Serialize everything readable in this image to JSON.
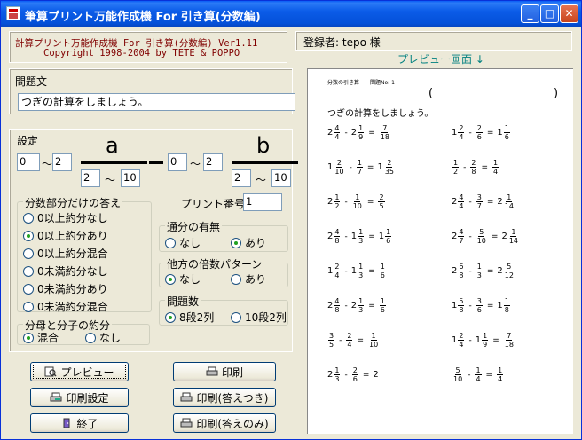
{
  "window": {
    "title": "筆算プリント万能作成機 For 引き算(分数編)"
  },
  "info": {
    "line1": "計算プリント万能作成機 For 引き算(分数編) Ver1.11",
    "line2": "Copyright 1998-2004 by TETE & POPPO"
  },
  "question": {
    "label": "問題文",
    "value": "つぎの計算をしましょう。"
  },
  "settings": {
    "label": "設定",
    "a_label": "a",
    "b_label": "b",
    "a_whole_from": "0",
    "a_whole_to": "2",
    "a_den_from": "2",
    "a_den_to": "10",
    "b_whole_from": "0",
    "b_whole_to": "2",
    "b_den_from": "2",
    "b_den_to": "10",
    "tilde": "〜"
  },
  "answer_group": {
    "label": "分数部分だけの答え",
    "options": [
      {
        "label": "0以上約分なし",
        "checked": false
      },
      {
        "label": "0以上約分あり",
        "checked": true
      },
      {
        "label": "0以上約分混合",
        "checked": false
      },
      {
        "label": "0未満約分なし",
        "checked": false
      },
      {
        "label": "0未満約分あり",
        "checked": false
      },
      {
        "label": "0未満約分混合",
        "checked": false
      }
    ]
  },
  "reduce_group": {
    "label": "分母と分子の約分",
    "options": [
      {
        "label": "混合",
        "checked": true
      },
      {
        "label": "なし",
        "checked": false
      }
    ]
  },
  "print_number": {
    "label": "プリント番号",
    "value": "1"
  },
  "tsubun_group": {
    "label": "通分の有無",
    "options": [
      {
        "label": "なし",
        "checked": false
      },
      {
        "label": "あり",
        "checked": true
      }
    ]
  },
  "multiple_group": {
    "label": "他方の倍数パターン",
    "options": [
      {
        "label": "なし",
        "checked": true
      },
      {
        "label": "あり",
        "checked": false
      }
    ]
  },
  "count_group": {
    "label": "問題数",
    "options": [
      {
        "label": "8段2列",
        "checked": true
      },
      {
        "label": "10段2列",
        "checked": false
      }
    ]
  },
  "buttons": {
    "preview": "プレビュー",
    "print_settings": "印刷設定",
    "exit": "終了",
    "print": "印刷",
    "print_with_answers": "印刷(答えつき)",
    "print_answers_only": "印刷(答えのみ)"
  },
  "registrant": "登録者: tepo 様",
  "preview_title": "プレビュー画面 ↓",
  "sheet": {
    "header": "分数の引き算　　問題No: 1",
    "paren_open": "(",
    "paren_close": ")",
    "instruction": "つぎの計算をしましょう。",
    "problems": [
      {
        "a": [
          "2",
          "4",
          "4"
        ],
        "b": [
          "2",
          "1",
          "9"
        ],
        "r": [
          "",
          "7",
          "18"
        ]
      },
      {
        "a": [
          "1",
          "2",
          "4"
        ],
        "b": [
          "",
          "2",
          "6"
        ],
        "r": [
          "1",
          "1",
          "6"
        ]
      },
      {
        "a": [
          "1",
          "2",
          "10"
        ],
        "b": [
          "",
          "1",
          "7"
        ],
        "r": [
          "1",
          "2",
          "35"
        ]
      },
      {
        "a": [
          "",
          "1",
          "2"
        ],
        "b": [
          "",
          "2",
          "8"
        ],
        "r": [
          "",
          "1",
          "4"
        ]
      },
      {
        "a": [
          "2",
          "1",
          "2"
        ],
        "b": [
          "",
          "1",
          "10"
        ],
        "r": [
          "",
          "2",
          "5"
        ]
      },
      {
        "a": [
          "2",
          "4",
          "4"
        ],
        "b": [
          "",
          "3",
          "7"
        ],
        "r": [
          "2",
          "1",
          "14"
        ]
      },
      {
        "a": [
          "2",
          "4",
          "8"
        ],
        "b": [
          "1",
          "1",
          "3"
        ],
        "r": [
          "1",
          "1",
          "6"
        ]
      },
      {
        "a": [
          "2",
          "4",
          "7"
        ],
        "b": [
          "",
          "5",
          "10"
        ],
        "r": [
          "2",
          "1",
          "14"
        ]
      },
      {
        "a": [
          "1",
          "2",
          "4"
        ],
        "b": [
          "1",
          "1",
          "3"
        ],
        "r": [
          "",
          "1",
          "6"
        ]
      },
      {
        "a": [
          "2",
          "6",
          "8"
        ],
        "b": [
          "",
          "1",
          "3"
        ],
        "r": [
          "2",
          "5",
          "12"
        ]
      },
      {
        "a": [
          "2",
          "4",
          "8"
        ],
        "b": [
          "2",
          "1",
          "3"
        ],
        "r": [
          "",
          "1",
          "6"
        ]
      },
      {
        "a": [
          "1",
          "5",
          "8"
        ],
        "b": [
          "",
          "3",
          "6"
        ],
        "r": [
          "1",
          "1",
          "8"
        ]
      },
      {
        "a": [
          "",
          "3",
          "5"
        ],
        "b": [
          "",
          "2",
          "4"
        ],
        "r": [
          "",
          "1",
          "10"
        ]
      },
      {
        "a": [
          "1",
          "2",
          "4"
        ],
        "b": [
          "1",
          "1",
          "9"
        ],
        "r": [
          "",
          "7",
          "18"
        ]
      },
      {
        "a": [
          "2",
          "1",
          "3"
        ],
        "b": [
          "",
          "2",
          "6"
        ],
        "r": [
          "2",
          "",
          ""
        ]
      },
      {
        "a": [
          "",
          "5",
          "10"
        ],
        "b": [
          "",
          "1",
          "4"
        ],
        "r": [
          "",
          "1",
          "4"
        ]
      }
    ]
  }
}
